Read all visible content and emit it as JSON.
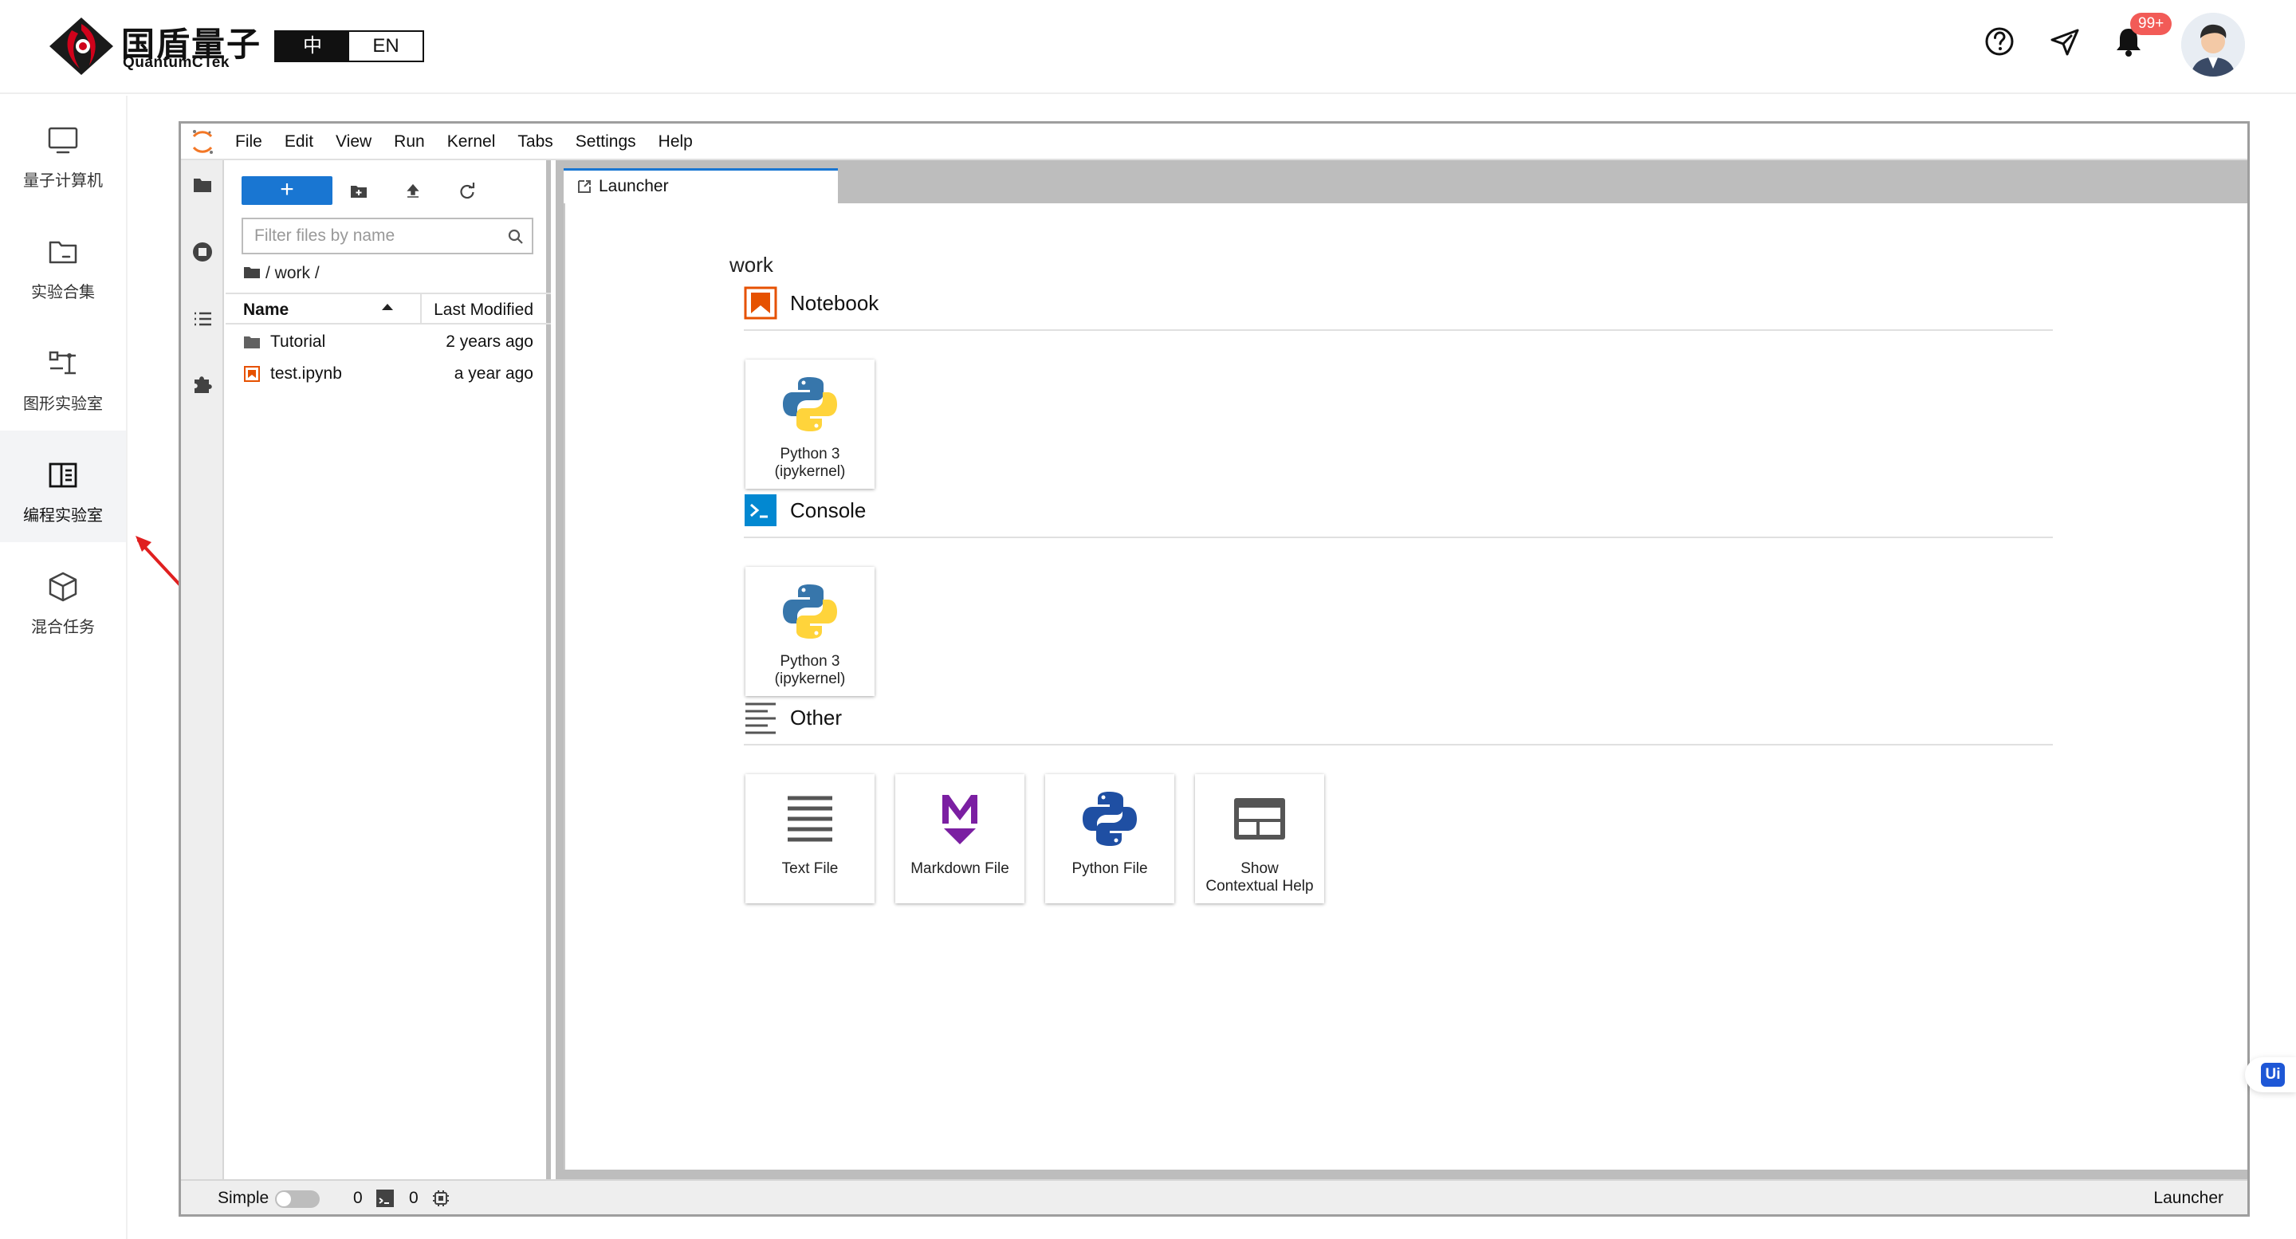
{
  "header": {
    "brand_cn": "国盾量子",
    "brand_en": "QuantumCTek",
    "lang_zh": "中",
    "lang_en": "EN",
    "notification_count": "99+",
    "icons": [
      "help-icon",
      "send-icon",
      "bell-icon",
      "avatar"
    ]
  },
  "nav": {
    "items": [
      {
        "label": "量子计算机",
        "icon": "monitor-icon"
      },
      {
        "label": "实验合集",
        "icon": "folder-icon"
      },
      {
        "label": "图形实验室",
        "icon": "circuit-icon"
      },
      {
        "label": "编程实验室",
        "icon": "book-icon",
        "selected": true
      },
      {
        "label": "混合任务",
        "icon": "cube-icon"
      }
    ]
  },
  "jupyter": {
    "menu": [
      "File",
      "Edit",
      "View",
      "Run",
      "Kernel",
      "Tabs",
      "Settings",
      "Help"
    ],
    "new_button": "+",
    "filter_placeholder": "Filter files by name",
    "breadcrumb": "/ work /",
    "columns": {
      "name": "Name",
      "modified": "Last Modified"
    },
    "files": [
      {
        "name": "Tutorial",
        "modified": "2 years ago",
        "type": "folder"
      },
      {
        "name": "test.ipynb",
        "modified": "a year ago",
        "type": "notebook"
      }
    ],
    "tab_label": "Launcher",
    "launcher": {
      "cwd": "work",
      "sections": [
        {
          "title": "Notebook",
          "cards": [
            "Python 3\n(ipykernel)"
          ]
        },
        {
          "title": "Console",
          "cards": [
            "Python 3\n(ipykernel)"
          ]
        },
        {
          "title": "Other",
          "cards": [
            "Text File",
            "Markdown File",
            "Python File",
            "Show\nContextual Help"
          ]
        }
      ]
    },
    "status": {
      "simple_label": "Simple",
      "terminals": "0",
      "kernels": "0",
      "mode": "Launcher"
    }
  },
  "floating_badge": "Ui",
  "colors": {
    "accent": "#1976d2",
    "notebook_orange": "#e65100",
    "console_blue": "#0288d1",
    "markdown_purple": "#7b1fa2",
    "badge_red": "#f25b57",
    "brand_red": "#d0021b"
  }
}
